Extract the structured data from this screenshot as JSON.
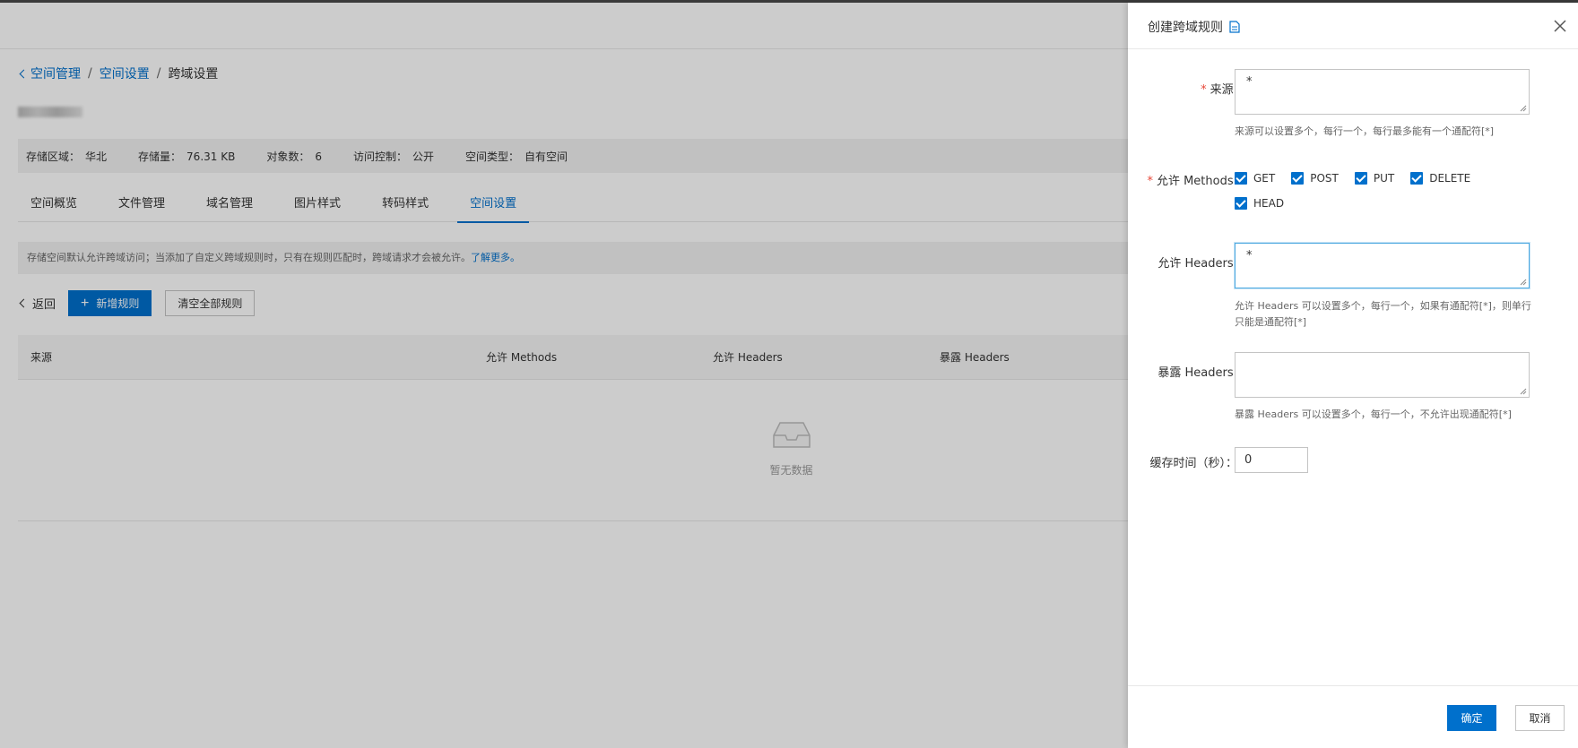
{
  "breadcrumb": {
    "items": [
      "空间管理",
      "空间设置",
      "跨域设置"
    ],
    "separator": "/"
  },
  "info": {
    "region_label": "存储区域：",
    "region_value": "华北",
    "storage_label": "存储量：",
    "storage_value": "76.31 KB",
    "objects_label": "对象数：",
    "objects_value": "6",
    "access_label": "访问控制：",
    "access_value": "公开",
    "type_label": "空间类型：",
    "type_value": "自有空间"
  },
  "tabs": [
    "空间概览",
    "文件管理",
    "域名管理",
    "图片样式",
    "转码样式",
    "空间设置"
  ],
  "notice": {
    "text": "存储空间默认允许跨域访问；当添加了自定义跨域规则时，只有在规则匹配时，跨域请求才会被允许。",
    "link": "了解更多。"
  },
  "actions": {
    "back": "返回",
    "add_rule": "新增规则",
    "clear_all": "清空全部规则"
  },
  "table": {
    "headers": [
      "来源",
      "允许 Methods",
      "允许 Headers",
      "暴露 Headers"
    ],
    "empty_text": "暂无数据"
  },
  "drawer": {
    "title": "创建跨域规则",
    "origin": {
      "label": "来源:",
      "value": "*",
      "hint": "来源可以设置多个，每行一个，每行最多能有一个通配符[*]"
    },
    "methods": {
      "label": "允许 Methods:",
      "options": [
        "GET",
        "POST",
        "PUT",
        "DELETE",
        "HEAD"
      ]
    },
    "allow_headers": {
      "label": "允许 Headers:",
      "value": "*",
      "hint": "允许 Headers 可以设置多个，每行一个，如果有通配符[*]，则单行只能是通配符[*]"
    },
    "expose_headers": {
      "label": "暴露 Headers:",
      "value": "",
      "hint": "暴露 Headers 可以设置多个，每行一个，不允许出现通配符[*]"
    },
    "cache": {
      "label": "缓存时间（秒）：",
      "value": "0"
    },
    "confirm": "确定",
    "cancel": "取消"
  },
  "colors": {
    "primary": "#0070cc",
    "required": "#e84738"
  }
}
